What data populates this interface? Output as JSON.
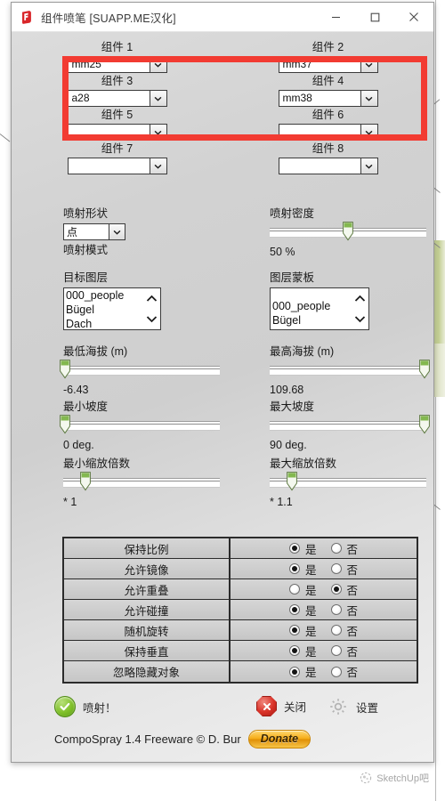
{
  "window": {
    "title": "组件喷笔 [SUAPP.ME汉化]",
    "app_icon": "sketchup-plugin-icon",
    "minimize_label": "—",
    "maximize_label": "□",
    "close_label": "✕",
    "accent_red": "#f23b32"
  },
  "components": {
    "slots": [
      {
        "label": "组件 1",
        "value": "mm25"
      },
      {
        "label": "组件 2",
        "value": "mm37"
      },
      {
        "label": "组件 3",
        "value": "a28"
      },
      {
        "label": "组件 4",
        "value": "mm38"
      },
      {
        "label": "组件 5",
        "value": ""
      },
      {
        "label": "组件 6",
        "value": ""
      },
      {
        "label": "组件 7",
        "value": ""
      },
      {
        "label": "组件 8",
        "value": ""
      }
    ]
  },
  "spray": {
    "shape_label": "喷射形状",
    "shape_value": "点",
    "mode_label": "喷射模式",
    "density_label": "喷射密度",
    "density_value": "50 %",
    "density_pct": 50
  },
  "layers": {
    "target_label": "目标图层",
    "target_items": [
      "000_people",
      "Bügel",
      "Dach"
    ],
    "mask_label": "图层蒙板",
    "mask_items": [
      "000_people",
      "Bügel"
    ]
  },
  "sliders": [
    {
      "label": "最低海拔 (m)",
      "value": "-6.43",
      "pct": 1
    },
    {
      "label": "最高海拔 (m)",
      "value": "109.68",
      "pct": 99
    },
    {
      "label": "最小坡度",
      "value": "0 deg.",
      "pct": 1
    },
    {
      "label": "最大坡度",
      "value": "90 deg.",
      "pct": 99
    },
    {
      "label": "最小缩放倍数",
      "value": "* 1",
      "pct": 14
    },
    {
      "label": "最大缩放倍数",
      "value": "* 1.1",
      "pct": 14
    }
  ],
  "options": {
    "yes_label": "是",
    "no_label": "否",
    "rows": [
      {
        "name": "保持比例",
        "selected": "yes"
      },
      {
        "name": "允许镜像",
        "selected": "yes"
      },
      {
        "name": "允许重叠",
        "selected": "no"
      },
      {
        "name": "允许碰撞",
        "selected": "yes"
      },
      {
        "name": "随机旋转",
        "selected": "yes"
      },
      {
        "name": "保持垂直",
        "selected": "yes"
      },
      {
        "name": "忽略隐藏对象",
        "selected": "yes"
      }
    ]
  },
  "actions": {
    "spray_label": "喷射！",
    "close_label": "关闭",
    "settings_label": "设置"
  },
  "credit": {
    "text": "CompoSpray 1.4 Freeware © D. Bur",
    "donate_label": "Donate"
  },
  "watermark": {
    "text": "SketchUp吧"
  }
}
